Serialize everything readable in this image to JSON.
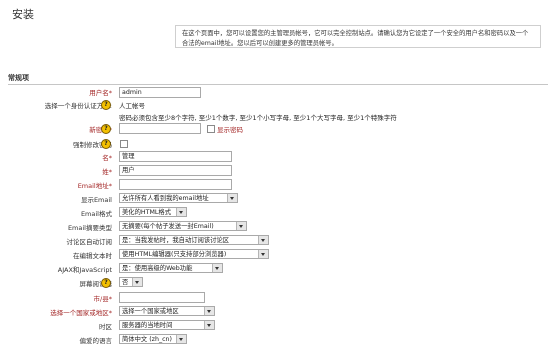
{
  "page": {
    "title": "安装"
  },
  "intro": {
    "text": "在这个页面中，您可以设置您的主管理员帐号，它可以完全控制站点。请确认您为它设定了一个安全的用户名和密码以及一个合法的email地址。您以后可以创建更多的管理员帐号。"
  },
  "section": {
    "header": "常规项"
  },
  "form": {
    "username": {
      "label": "用户名",
      "required": "*",
      "value": "admin"
    },
    "auth": {
      "label": "选择一个身份认证方法:",
      "value": "人工帐号"
    },
    "password_rules": {
      "text": "密码必须包含至少8个字符, 至少1个数字, 至少1个小写字母, 至少1个大写字母, 至少1个特殊字符"
    },
    "new_password": {
      "label": "新密码",
      "required": "*",
      "value": "",
      "reveal_label": "显示密码"
    },
    "force_change": {
      "label": "强制修改密码"
    },
    "firstname": {
      "label": "名",
      "required": "*",
      "value": "管理"
    },
    "lastname": {
      "label": "姓",
      "required": "*",
      "value": "用户"
    },
    "email": {
      "label": "Email地址",
      "required": "*",
      "value": ""
    },
    "email_display": {
      "label": "显示Email",
      "value": "允许所有人看到我的email地址"
    },
    "email_format": {
      "label": "Email格式",
      "value": "美化的HTML格式"
    },
    "digest": {
      "label": "Email摘要类型",
      "value": "无摘要(每个帖子发送一封Email)"
    },
    "autosubscribe": {
      "label": "讨论区自动订阅",
      "value": "是：当我发帖时，我自动订阅该讨论区"
    },
    "editor": {
      "label": "在编辑文本时",
      "value": "使用HTML编辑器(只支持部分浏览器)"
    },
    "ajax": {
      "label": "AJAX和JavaScript",
      "value": "是：使用高级的Web功能"
    },
    "screenreader": {
      "label": "屏幕阅读器",
      "value": "否"
    },
    "city": {
      "label": "市/县",
      "required": "*",
      "value": ""
    },
    "country": {
      "label": "选择一个国家或地区",
      "required": "*",
      "value": "选择一个国家或地区"
    },
    "timezone": {
      "label": "时区",
      "value": "服务器的当地时间"
    },
    "language": {
      "label": "偏爱的语言",
      "value": "简体中文 (zh_cn)"
    }
  },
  "icons": {
    "help": "help-icon"
  },
  "colors": {
    "required": "#a32626",
    "help_icon": "#f3c000"
  }
}
